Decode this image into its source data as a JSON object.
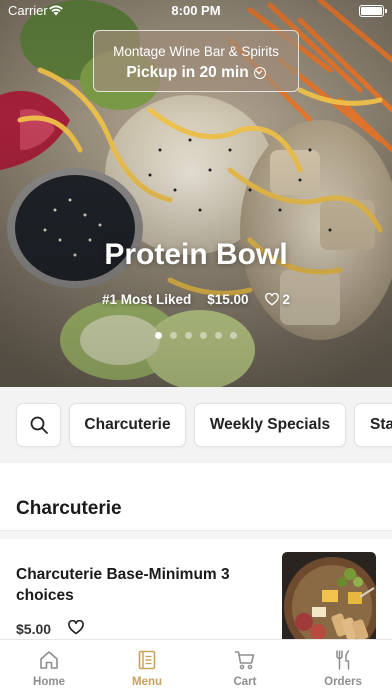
{
  "status_bar": {
    "carrier": "Carrier",
    "time": "8:00 PM"
  },
  "pickup": {
    "venue": "Montage Wine Bar & Spirits",
    "status": "Pickup in 20 min",
    "icon": "chevron-down-circle-icon"
  },
  "hero": {
    "title": "Protein Bowl",
    "rank": "#1 Most Liked",
    "price": "$15.00",
    "likes": "2",
    "carousel": {
      "count": 6,
      "active_index": 0
    }
  },
  "categories": {
    "search_icon": "search-icon",
    "items": [
      {
        "label": "Charcuterie"
      },
      {
        "label": "Weekly Specials"
      },
      {
        "label": "Sta"
      }
    ]
  },
  "menu": {
    "section_title": "Charcuterie",
    "items": [
      {
        "name": "Charcuterie Base-Minimum 3 choices",
        "price": "$5.00",
        "favorite_icon": "heart-outline-icon"
      }
    ]
  },
  "tab_bar": {
    "tabs": [
      {
        "label": "Home",
        "icon": "home-icon",
        "active": false
      },
      {
        "label": "Menu",
        "icon": "menu-book-icon",
        "active": true
      },
      {
        "label": "Cart",
        "icon": "cart-icon",
        "active": false
      },
      {
        "label": "Orders",
        "icon": "fork-knife-icon",
        "active": false
      }
    ]
  },
  "colors": {
    "accent": "#c8a15a",
    "inactive": "#8e8e8e",
    "category_bar_bg": "#f3f3f3",
    "pickup_card_bg": "#a08c78"
  }
}
